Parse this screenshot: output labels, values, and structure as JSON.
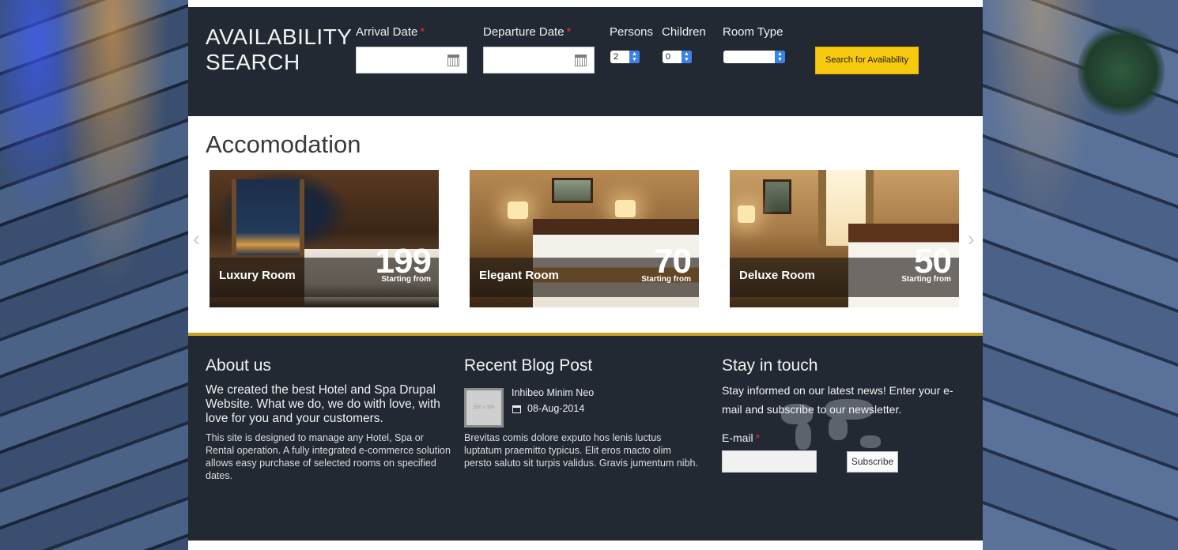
{
  "search": {
    "title_line1": "AVAILABILITY",
    "title_line2": "SEARCH",
    "arrival_label": "Arrival Date",
    "departure_label": "Departure Date",
    "required_mark": "*",
    "persons_label": "Persons",
    "children_label": "Children",
    "room_type_label": "Room Type",
    "persons_value": "2",
    "children_value": "0",
    "room_type_value": "",
    "arrival_value": "",
    "departure_value": "",
    "button_label": "Search for Availability",
    "button_color": "#f7c90f"
  },
  "accommodation": {
    "title": "Accomodation",
    "prev_arrow": "‹",
    "next_arrow": "›",
    "rooms": [
      {
        "name": "Luxury Room",
        "price": "199",
        "price_caption": "Starting from"
      },
      {
        "name": "Elegant Room",
        "price": "70",
        "price_caption": "Starting from"
      },
      {
        "name": "Deluxe Room",
        "price": "50",
        "price_caption": "Starting from"
      }
    ]
  },
  "footer": {
    "about": {
      "heading": "About us",
      "lead": "We created the best Hotel and Spa Drupal Website. What we do, we do with love, with love for you and your customers.",
      "body": "This site is designed to manage any Hotel, Spa or Rental operation. A fully integrated e-commerce solution allows easy purchase of selected rooms on specified dates."
    },
    "blog": {
      "heading": "Recent Blog Post",
      "thumb_text": "550 x 359",
      "post_title": "Inhibeo Minim Neo",
      "post_date": "08-Aug-2014",
      "post_body": "Brevitas comis dolore exputo hos lenis luctus luptatum praemitto typicus. Elit eros macto olim persto saluto sit turpis validus. Gravis jumentum nibh."
    },
    "newsletter": {
      "heading": "Stay in touch",
      "text": "Stay informed on our latest news! Enter your e-mail and subscribe to our newsletter.",
      "email_label": "E-mail",
      "email_value": "",
      "subscribe_label": "Subscribe"
    }
  },
  "colors": {
    "panel_dark": "#232933",
    "accent_gold": "#c4a227",
    "required_red": "#e0322f"
  }
}
